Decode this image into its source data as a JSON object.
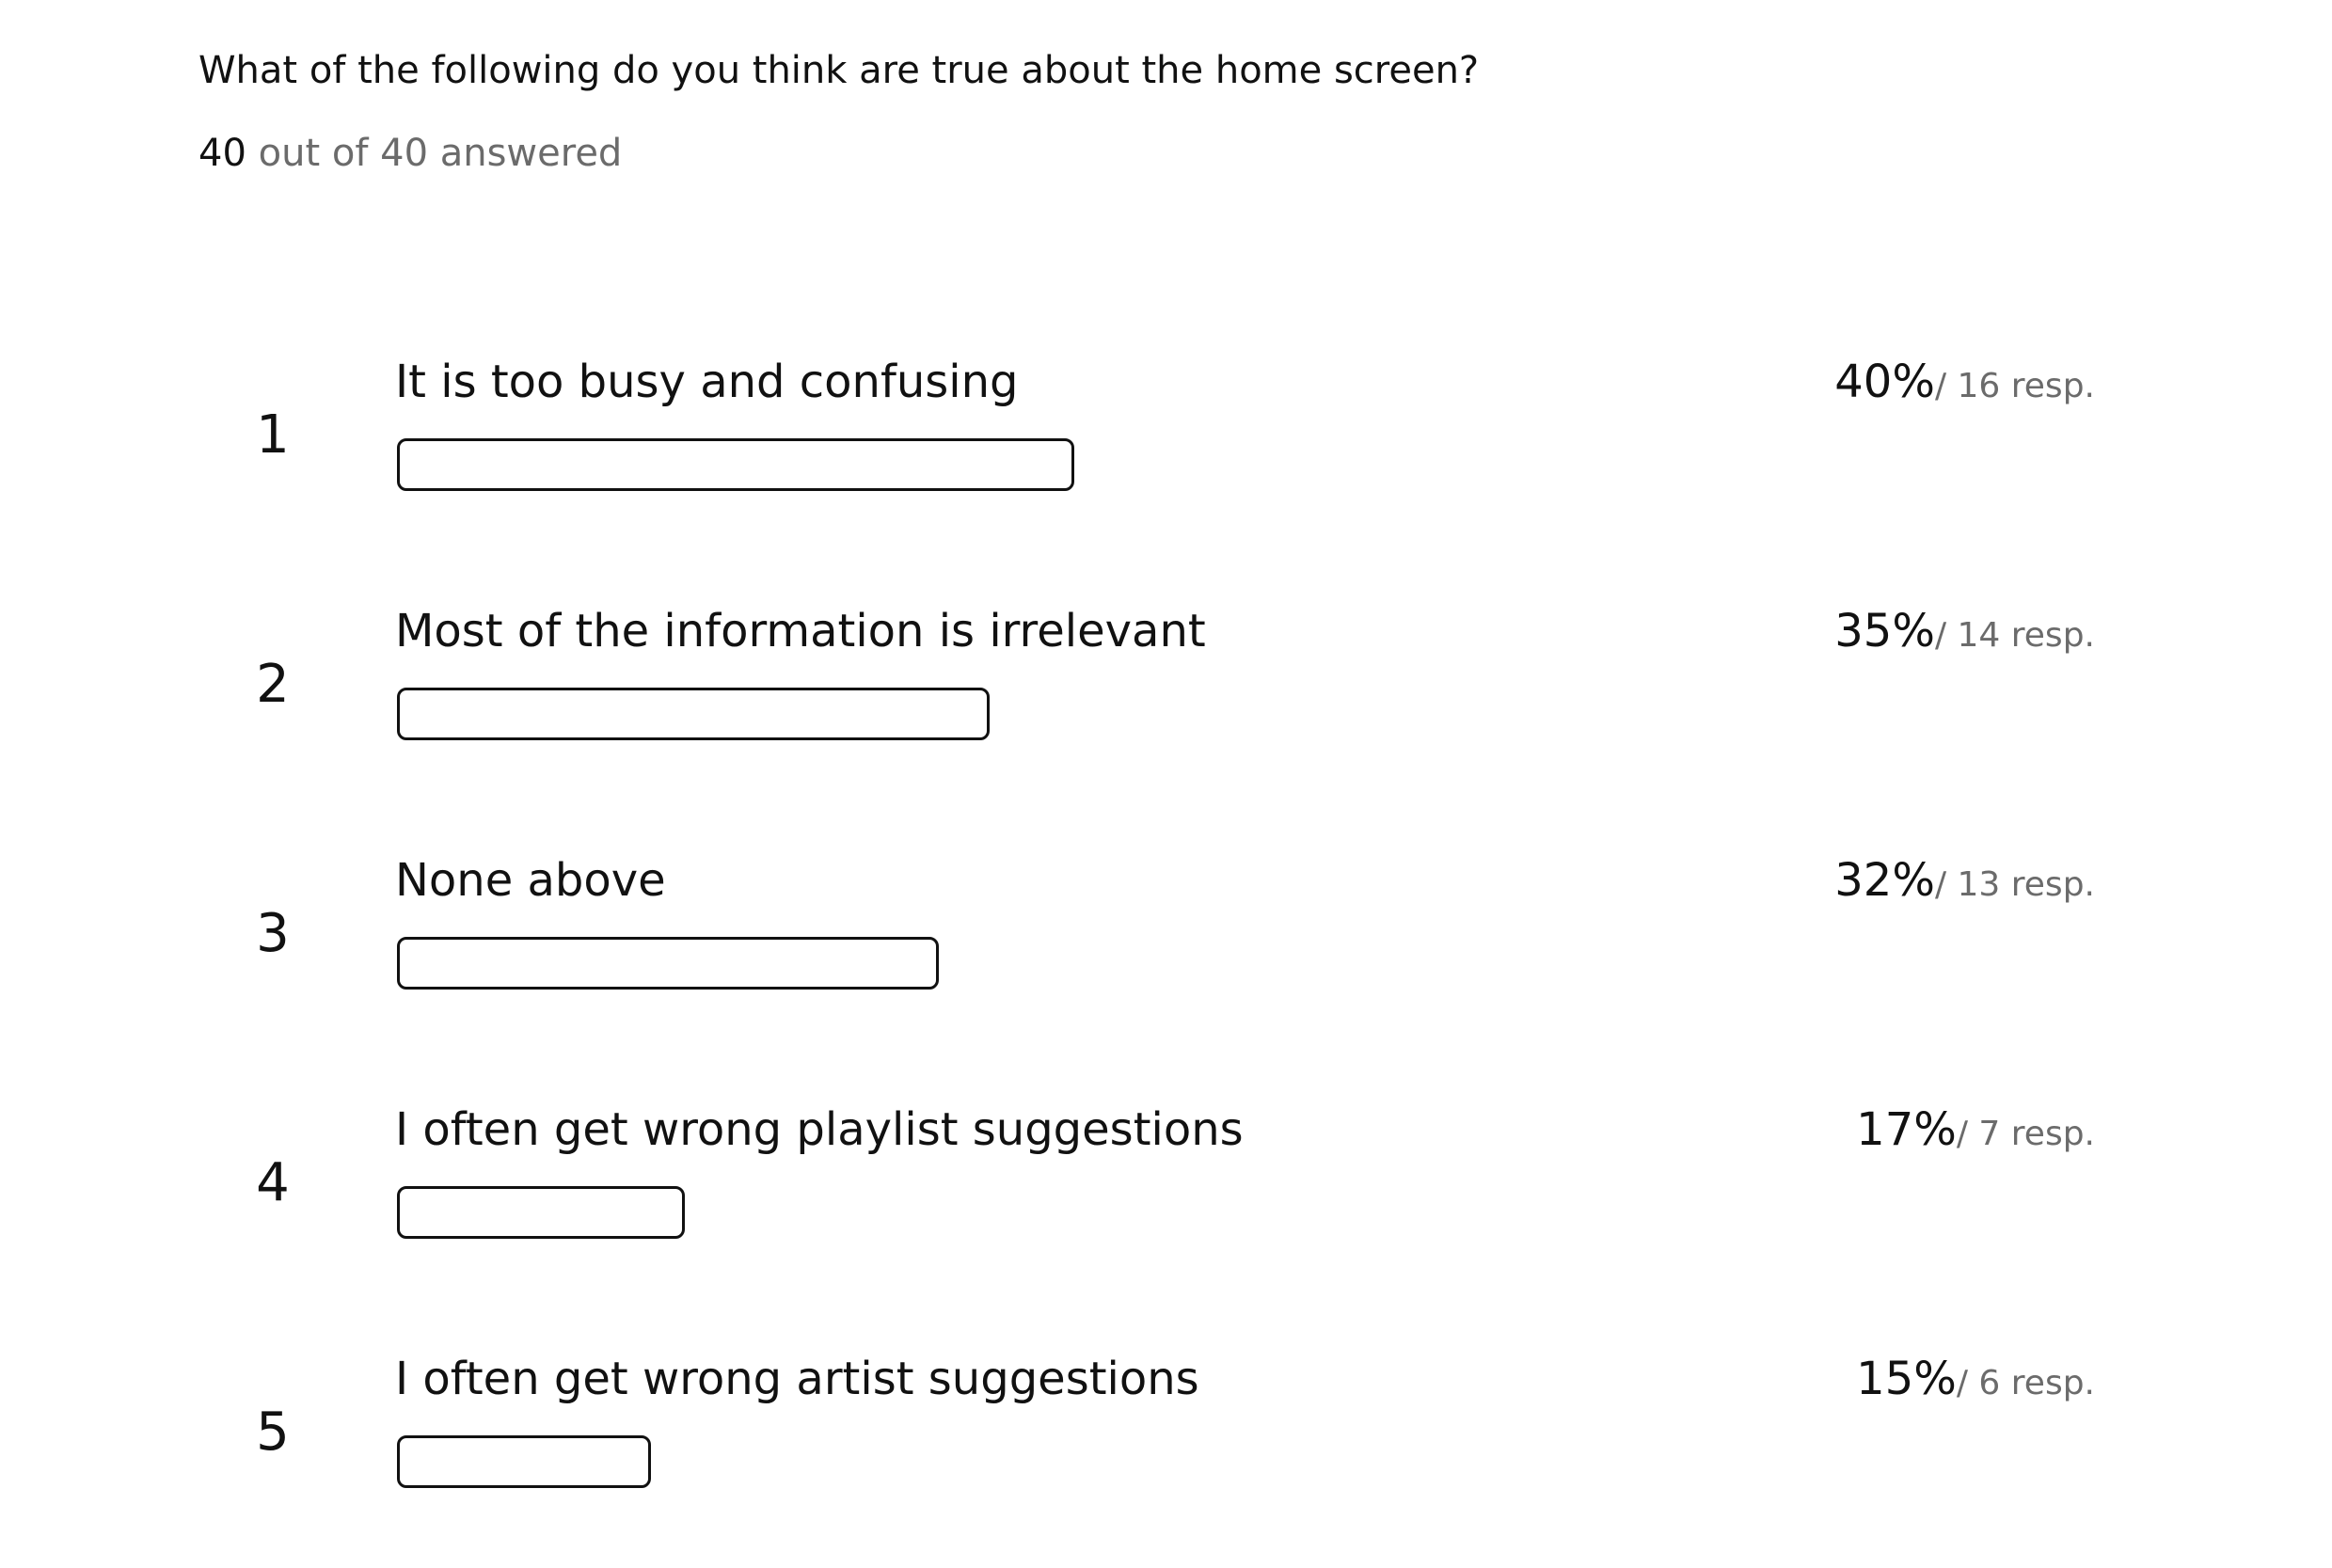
{
  "question": "What of the following do you think are true about the home screen?",
  "answered": {
    "count": "40",
    "rest": "out of 40 answered"
  },
  "chart_data": {
    "type": "bar",
    "orientation": "horizontal",
    "categories": [
      "It is too busy and confusing",
      "Most of the information is irrelevant",
      "None above",
      "I often get wrong playlist suggestions",
      "I often get wrong artist suggestions"
    ],
    "values": [
      40,
      35,
      32,
      17,
      15
    ],
    "responses": [
      16,
      14,
      13,
      7,
      6
    ],
    "ranks": [
      "1",
      "2",
      "3",
      "4",
      "5"
    ],
    "percent_labels": [
      "40%",
      "35%",
      "32%",
      "17%",
      "15%"
    ],
    "response_labels": [
      "/ 16 resp.",
      "/ 14 resp.",
      "/ 13 resp.",
      "/ 7 resp.",
      "/ 6 resp."
    ],
    "xlim": [
      0,
      100
    ],
    "grid": false,
    "bar_fill": "#ffffff",
    "bar_outline": "#111111"
  }
}
